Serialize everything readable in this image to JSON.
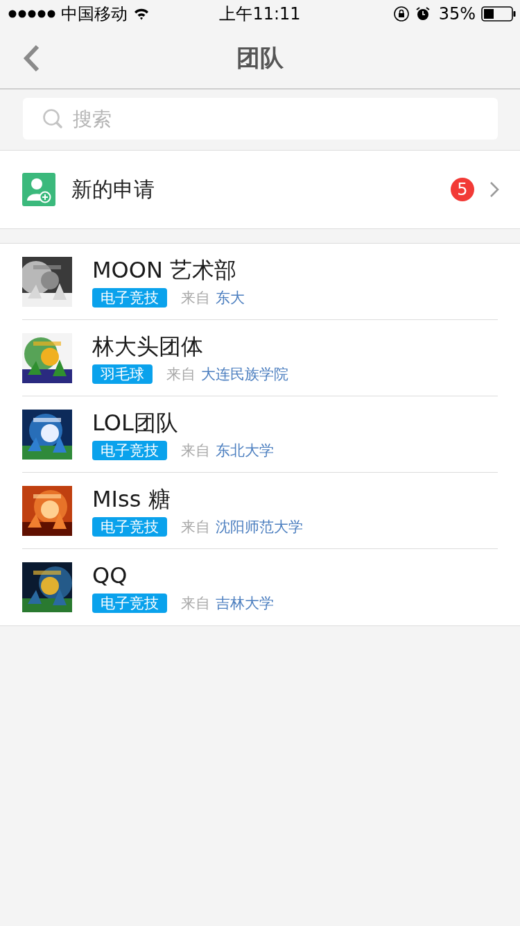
{
  "status_bar": {
    "carrier": "中国移动",
    "time": "上午11:11",
    "battery": "35%"
  },
  "nav": {
    "title": "团队"
  },
  "search": {
    "placeholder": "搜索"
  },
  "new_request": {
    "label": "新的申请",
    "badge": "5"
  },
  "teams": [
    {
      "name": "MOON 艺术部",
      "tag": "电子竞技",
      "from_label": "来自",
      "school": "东大"
    },
    {
      "name": "林大头团体",
      "tag": "羽毛球",
      "from_label": "来自",
      "school": "大连民族学院"
    },
    {
      "name": "LOL团队",
      "tag": "电子竞技",
      "from_label": "来自",
      "school": "东北大学"
    },
    {
      "name": "MIss 糖",
      "tag": "电子竞技",
      "from_label": "来自",
      "school": "沈阳师范大学"
    },
    {
      "name": "QQ",
      "tag": "电子竞技",
      "from_label": "来自",
      "school": "吉林大学"
    }
  ]
}
